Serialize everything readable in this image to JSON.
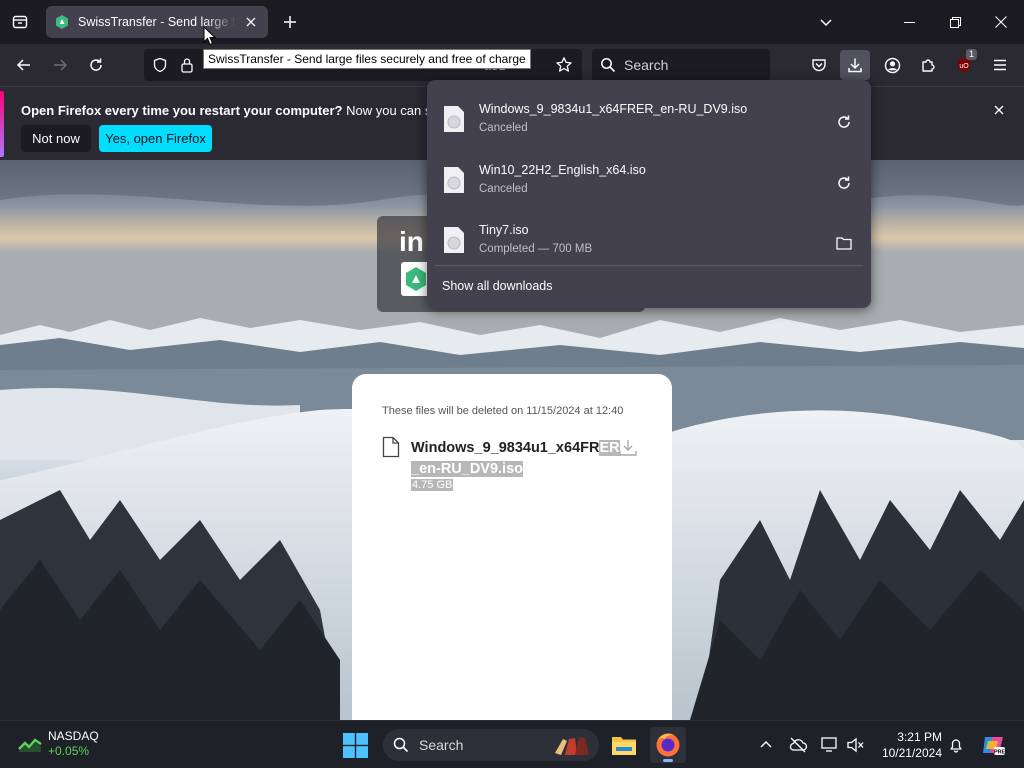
{
  "browser": {
    "tab": {
      "title": "SwissTransfer - Send large files securely and free of charge"
    },
    "tooltip": "SwissTransfer - Send large files securely and free of charge",
    "url_fragment": "a51",
    "search": {
      "placeholder": "Search"
    },
    "extension_badge": "1",
    "accent": "#00ddff"
  },
  "notification": {
    "bold": "Open Firefox every time you restart your computer?",
    "rest": " Now you can set Fire",
    "not_now": "Not now",
    "yes": "Yes, open Firefox"
  },
  "downloads": {
    "items": [
      {
        "name": "Windows_9_9834u1_x64FRER_en-RU_DV9.iso",
        "status": "Canceled",
        "action": "retry-icon"
      },
      {
        "name": "Win10_22H2_English_x64.iso",
        "status": "Canceled",
        "action": "retry-icon"
      },
      {
        "name": "Tiny7.iso",
        "status": "Completed — 700 MB",
        "action": "folder-icon"
      }
    ],
    "show_all": "Show all downloads"
  },
  "page": {
    "card_partial_text": "in",
    "expiry": "These files will be deleted on 11/15/2024 at 12:40",
    "file": {
      "name_a": "Windows_9_9834u1_x64FR",
      "name_b": "ER",
      "name_c": "_en-RU_DV9.iso",
      "size": "4.75 GB"
    }
  },
  "taskbar": {
    "widget": {
      "title": "NASDAQ",
      "change": "+0.05%"
    },
    "search_label": "Search",
    "time": "3:21 PM",
    "date": "10/21/2024"
  }
}
